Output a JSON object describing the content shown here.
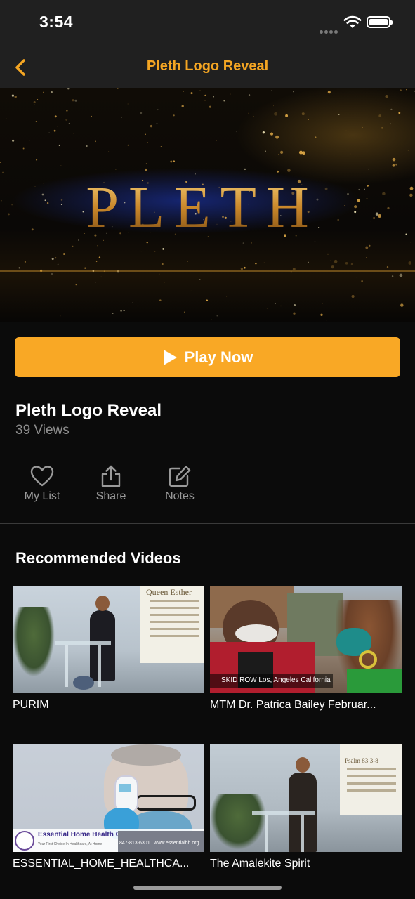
{
  "status_bar": {
    "time": "3:54"
  },
  "nav": {
    "title": "Pleth Logo Reveal"
  },
  "hero": {
    "logo_text": "PLETH"
  },
  "play_button": {
    "label": "Play Now"
  },
  "video": {
    "title": "Pleth Logo Reveal",
    "views": "39 Views"
  },
  "actions": [
    {
      "label": "My List",
      "icon": "heart-icon"
    },
    {
      "label": "Share",
      "icon": "share-icon"
    },
    {
      "label": "Notes",
      "icon": "edit-icon"
    }
  ],
  "recommended": {
    "heading": "Recommended Videos",
    "items": [
      {
        "title": "PURIM",
        "thumb_text": "Queen Esther"
      },
      {
        "title": "MTM Dr. Patrica Bailey Februar...",
        "thumb_text": "SKID ROW Los, Angeles California"
      },
      {
        "title": "ESSENTIAL_HOME_HEALTHCA...",
        "thumb_text": "Essential Home Health Care",
        "thumb_subtext": "Your First Choice In Healthcare, At Home",
        "thumb_contact": "847-813-6301 | www.essentialhh.org"
      },
      {
        "title": "The Amalekite Spirit",
        "thumb_text": "Psalm 83:3-8"
      }
    ]
  },
  "colors": {
    "accent": "#f5a623",
    "button": "#f9a825",
    "bar": "#202020",
    "background": "#0b0b0b"
  }
}
